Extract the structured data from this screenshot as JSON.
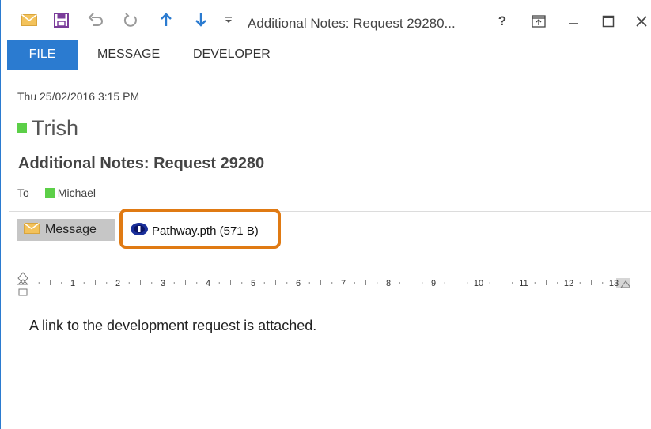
{
  "window": {
    "title": "Additional Notes: Request 29280...",
    "help_label": "?"
  },
  "ribbon": {
    "tabs": [
      {
        "label": "FILE"
      },
      {
        "label": "MESSAGE"
      },
      {
        "label": "DEVELOPER"
      }
    ]
  },
  "header": {
    "date": "Thu 25/02/2016 3:15 PM",
    "sender": "Trish",
    "subject": "Additional Notes: Request 29280",
    "to_label": "To",
    "recipient": "Michael"
  },
  "attachments": {
    "message_tab": "Message",
    "file": "Pathway.pth (571 B)"
  },
  "ruler": {
    "numbers": [
      "1",
      "2",
      "3",
      "4",
      "5",
      "6",
      "7",
      "8",
      "9",
      "10",
      "11",
      "12",
      "13"
    ]
  },
  "body": {
    "text": "A link to the development request is attached."
  },
  "colors": {
    "accent": "#2b7bd0",
    "presence": "#5ccf48",
    "highlight": "#e07a13"
  }
}
